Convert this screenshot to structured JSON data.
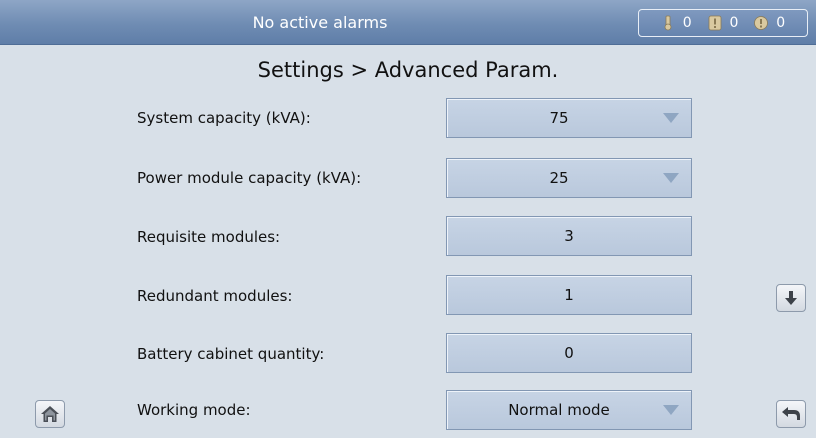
{
  "header": {
    "alarm_status": "No active alarms",
    "alarm_counts": [
      {
        "icon": "critical-alarm-icon",
        "count": "0"
      },
      {
        "icon": "major-alarm-icon",
        "count": "0"
      },
      {
        "icon": "minor-alarm-icon",
        "count": "0"
      }
    ]
  },
  "page": {
    "title": "Settings > Advanced Param."
  },
  "params": [
    {
      "label": "System capacity (kVA):",
      "value": "75",
      "type": "dropdown"
    },
    {
      "label": "Power module capacity (kVA):",
      "value": "25",
      "type": "dropdown"
    },
    {
      "label": "Requisite modules:",
      "value": "3",
      "type": "input"
    },
    {
      "label": "Redundant modules:",
      "value": "1",
      "type": "input"
    },
    {
      "label": "Battery cabinet quantity:",
      "value": "0",
      "type": "input"
    },
    {
      "label": "Working mode:",
      "value": "Normal mode",
      "type": "dropdown"
    }
  ],
  "nav": {
    "home_icon": "home-icon",
    "scroll_down_icon": "arrow-down-icon",
    "back_icon": "back-arrow-icon"
  },
  "colors": {
    "header_bg": "#6f8cb3",
    "page_bg": "#d8e0e8",
    "field_bg": "#c0cee1",
    "field_border": "#8297b3"
  }
}
